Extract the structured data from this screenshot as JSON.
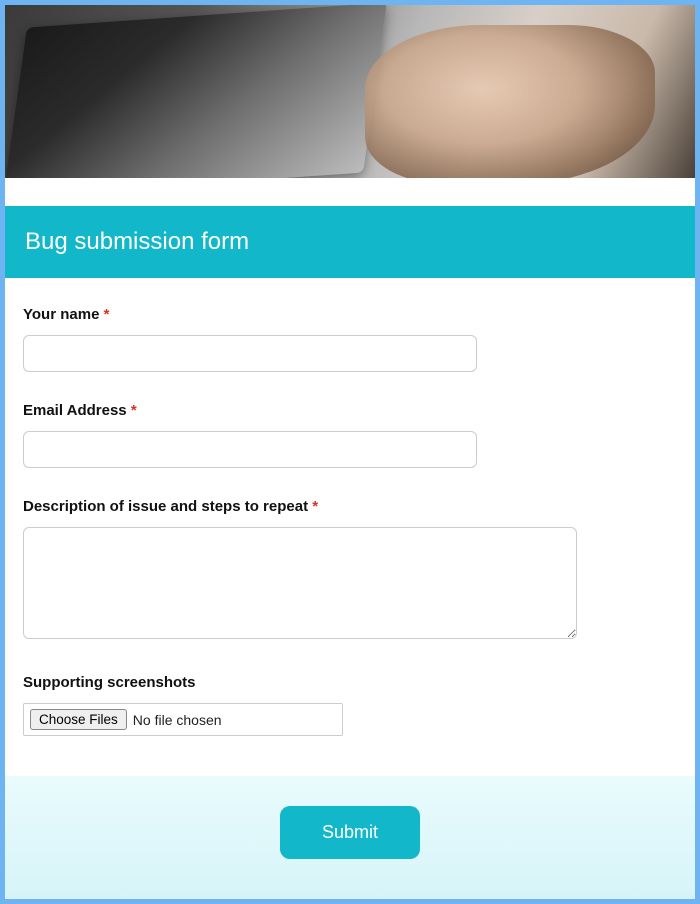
{
  "header": {
    "title": "Bug submission form"
  },
  "fields": {
    "name": {
      "label": "Your name",
      "required_marker": "*",
      "value": ""
    },
    "email": {
      "label": "Email Address",
      "required_marker": "*",
      "value": ""
    },
    "description": {
      "label": "Description of issue and steps to repeat",
      "required_marker": "*",
      "value": ""
    },
    "screenshots": {
      "label": "Supporting screenshots",
      "button_label": "Choose Files",
      "status_text": "No file chosen"
    }
  },
  "submit": {
    "label": "Submit"
  }
}
